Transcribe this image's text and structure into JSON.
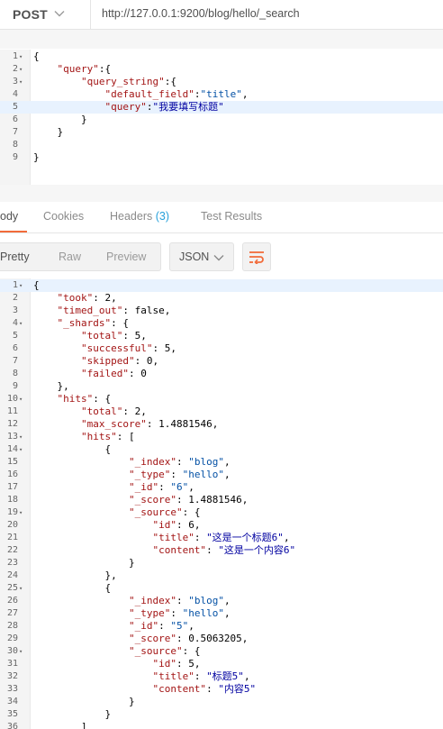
{
  "request": {
    "method": "POST",
    "url": "http://127.0.0.1:9200/blog/hello/_search"
  },
  "request_body": {
    "lines": [
      {
        "n": "1",
        "fold": true,
        "tokens": [
          [
            "p",
            "{"
          ]
        ]
      },
      {
        "n": "2",
        "fold": true,
        "tokens": [
          [
            "p",
            "    "
          ],
          [
            "k",
            "\"query\""
          ],
          [
            "p",
            ":{"
          ]
        ]
      },
      {
        "n": "3",
        "fold": true,
        "tokens": [
          [
            "p",
            "        "
          ],
          [
            "k",
            "\"query_string\""
          ],
          [
            "p",
            ":{"
          ]
        ]
      },
      {
        "n": "4",
        "fold": false,
        "tokens": [
          [
            "p",
            "            "
          ],
          [
            "k",
            "\"default_field\""
          ],
          [
            "p",
            ":"
          ],
          [
            "s",
            "\"title\""
          ],
          [
            "p",
            ","
          ]
        ]
      },
      {
        "n": "5",
        "fold": false,
        "active": true,
        "tokens": [
          [
            "p",
            "            "
          ],
          [
            "k",
            "\"query\""
          ],
          [
            "p",
            ":"
          ],
          [
            "s2",
            "\"我要填写标题\""
          ]
        ]
      },
      {
        "n": "6",
        "fold": false,
        "tokens": [
          [
            "p",
            "        }"
          ]
        ]
      },
      {
        "n": "7",
        "fold": false,
        "tokens": [
          [
            "p",
            "    }"
          ]
        ]
      },
      {
        "n": "8",
        "fold": false,
        "tokens": []
      },
      {
        "n": "9",
        "fold": false,
        "tokens": [
          [
            "p",
            "}"
          ]
        ]
      }
    ]
  },
  "response_tabs": [
    {
      "label": "ody",
      "active": true
    },
    {
      "label": "Cookies"
    },
    {
      "label": "Headers",
      "count": "(3)"
    },
    {
      "label": "Test Results"
    }
  ],
  "format_bar": {
    "modes": [
      "Pretty",
      "Raw",
      "Preview"
    ],
    "active_mode": "Pretty",
    "language": "JSON",
    "wrap_icon": "wrap-lines-icon",
    "accent_color": "#f26b3a"
  },
  "response_body": {
    "lines": [
      {
        "n": "1",
        "fold": true,
        "active": true,
        "tokens": [
          [
            "p",
            "{"
          ]
        ]
      },
      {
        "n": "2",
        "fold": false,
        "tokens": [
          [
            "p",
            "    "
          ],
          [
            "k",
            "\"took\""
          ],
          [
            "p",
            ": 2,"
          ]
        ]
      },
      {
        "n": "3",
        "fold": false,
        "tokens": [
          [
            "p",
            "    "
          ],
          [
            "k",
            "\"timed_out\""
          ],
          [
            "p",
            ": false,"
          ]
        ]
      },
      {
        "n": "4",
        "fold": true,
        "tokens": [
          [
            "p",
            "    "
          ],
          [
            "k",
            "\"_shards\""
          ],
          [
            "p",
            ": {"
          ]
        ]
      },
      {
        "n": "5",
        "fold": false,
        "tokens": [
          [
            "p",
            "        "
          ],
          [
            "k",
            "\"total\""
          ],
          [
            "p",
            ": 5,"
          ]
        ]
      },
      {
        "n": "6",
        "fold": false,
        "tokens": [
          [
            "p",
            "        "
          ],
          [
            "k",
            "\"successful\""
          ],
          [
            "p",
            ": 5,"
          ]
        ]
      },
      {
        "n": "7",
        "fold": false,
        "tokens": [
          [
            "p",
            "        "
          ],
          [
            "k",
            "\"skipped\""
          ],
          [
            "p",
            ": 0,"
          ]
        ]
      },
      {
        "n": "8",
        "fold": false,
        "tokens": [
          [
            "p",
            "        "
          ],
          [
            "k",
            "\"failed\""
          ],
          [
            "p",
            ": 0"
          ]
        ]
      },
      {
        "n": "9",
        "fold": false,
        "tokens": [
          [
            "p",
            "    },"
          ]
        ]
      },
      {
        "n": "10",
        "fold": true,
        "tokens": [
          [
            "p",
            "    "
          ],
          [
            "k",
            "\"hits\""
          ],
          [
            "p",
            ": {"
          ]
        ]
      },
      {
        "n": "11",
        "fold": false,
        "tokens": [
          [
            "p",
            "        "
          ],
          [
            "k",
            "\"total\""
          ],
          [
            "p",
            ": 2,"
          ]
        ]
      },
      {
        "n": "12",
        "fold": false,
        "tokens": [
          [
            "p",
            "        "
          ],
          [
            "k",
            "\"max_score\""
          ],
          [
            "p",
            ": 1.4881546,"
          ]
        ]
      },
      {
        "n": "13",
        "fold": true,
        "tokens": [
          [
            "p",
            "        "
          ],
          [
            "k",
            "\"hits\""
          ],
          [
            "p",
            ": ["
          ]
        ]
      },
      {
        "n": "14",
        "fold": true,
        "tokens": [
          [
            "p",
            "            {"
          ]
        ]
      },
      {
        "n": "15",
        "fold": false,
        "tokens": [
          [
            "p",
            "                "
          ],
          [
            "k",
            "\"_index\""
          ],
          [
            "p",
            ": "
          ],
          [
            "s",
            "\"blog\""
          ],
          [
            "p",
            ","
          ]
        ]
      },
      {
        "n": "16",
        "fold": false,
        "tokens": [
          [
            "p",
            "                "
          ],
          [
            "k",
            "\"_type\""
          ],
          [
            "p",
            ": "
          ],
          [
            "s",
            "\"hello\""
          ],
          [
            "p",
            ","
          ]
        ]
      },
      {
        "n": "17",
        "fold": false,
        "tokens": [
          [
            "p",
            "                "
          ],
          [
            "k",
            "\"_id\""
          ],
          [
            "p",
            ": "
          ],
          [
            "s",
            "\"6\""
          ],
          [
            "p",
            ","
          ]
        ]
      },
      {
        "n": "18",
        "fold": false,
        "tokens": [
          [
            "p",
            "                "
          ],
          [
            "k",
            "\"_score\""
          ],
          [
            "p",
            ": 1.4881546,"
          ]
        ]
      },
      {
        "n": "19",
        "fold": true,
        "tokens": [
          [
            "p",
            "                "
          ],
          [
            "k",
            "\"_source\""
          ],
          [
            "p",
            ": {"
          ]
        ]
      },
      {
        "n": "20",
        "fold": false,
        "tokens": [
          [
            "p",
            "                    "
          ],
          [
            "k",
            "\"id\""
          ],
          [
            "p",
            ": 6,"
          ]
        ]
      },
      {
        "n": "21",
        "fold": false,
        "tokens": [
          [
            "p",
            "                    "
          ],
          [
            "k",
            "\"title\""
          ],
          [
            "p",
            ": "
          ],
          [
            "s2",
            "\"这是一个标题6\""
          ],
          [
            "p",
            ","
          ]
        ]
      },
      {
        "n": "22",
        "fold": false,
        "tokens": [
          [
            "p",
            "                    "
          ],
          [
            "k",
            "\"content\""
          ],
          [
            "p",
            ": "
          ],
          [
            "s2",
            "\"这是一个内容6\""
          ]
        ]
      },
      {
        "n": "23",
        "fold": false,
        "tokens": [
          [
            "p",
            "                }"
          ]
        ]
      },
      {
        "n": "24",
        "fold": false,
        "tokens": [
          [
            "p",
            "            },"
          ]
        ]
      },
      {
        "n": "25",
        "fold": true,
        "tokens": [
          [
            "p",
            "            {"
          ]
        ]
      },
      {
        "n": "26",
        "fold": false,
        "tokens": [
          [
            "p",
            "                "
          ],
          [
            "k",
            "\"_index\""
          ],
          [
            "p",
            ": "
          ],
          [
            "s",
            "\"blog\""
          ],
          [
            "p",
            ","
          ]
        ]
      },
      {
        "n": "27",
        "fold": false,
        "tokens": [
          [
            "p",
            "                "
          ],
          [
            "k",
            "\"_type\""
          ],
          [
            "p",
            ": "
          ],
          [
            "s",
            "\"hello\""
          ],
          [
            "p",
            ","
          ]
        ]
      },
      {
        "n": "28",
        "fold": false,
        "tokens": [
          [
            "p",
            "                "
          ],
          [
            "k",
            "\"_id\""
          ],
          [
            "p",
            ": "
          ],
          [
            "s",
            "\"5\""
          ],
          [
            "p",
            ","
          ]
        ]
      },
      {
        "n": "29",
        "fold": false,
        "tokens": [
          [
            "p",
            "                "
          ],
          [
            "k",
            "\"_score\""
          ],
          [
            "p",
            ": 0.5063205,"
          ]
        ]
      },
      {
        "n": "30",
        "fold": true,
        "tokens": [
          [
            "p",
            "                "
          ],
          [
            "k",
            "\"_source\""
          ],
          [
            "p",
            ": {"
          ]
        ]
      },
      {
        "n": "31",
        "fold": false,
        "tokens": [
          [
            "p",
            "                    "
          ],
          [
            "k",
            "\"id\""
          ],
          [
            "p",
            ": 5,"
          ]
        ]
      },
      {
        "n": "32",
        "fold": false,
        "tokens": [
          [
            "p",
            "                    "
          ],
          [
            "k",
            "\"title\""
          ],
          [
            "p",
            ": "
          ],
          [
            "s2",
            "\"标题5\""
          ],
          [
            "p",
            ","
          ]
        ]
      },
      {
        "n": "33",
        "fold": false,
        "tokens": [
          [
            "p",
            "                    "
          ],
          [
            "k",
            "\"content\""
          ],
          [
            "p",
            ": "
          ],
          [
            "s2",
            "\"内容5\""
          ]
        ]
      },
      {
        "n": "34",
        "fold": false,
        "tokens": [
          [
            "p",
            "                }"
          ]
        ]
      },
      {
        "n": "35",
        "fold": false,
        "tokens": [
          [
            "p",
            "            }"
          ]
        ]
      },
      {
        "n": "36",
        "fold": false,
        "tokens": [
          [
            "p",
            "        ]"
          ]
        ]
      }
    ]
  }
}
